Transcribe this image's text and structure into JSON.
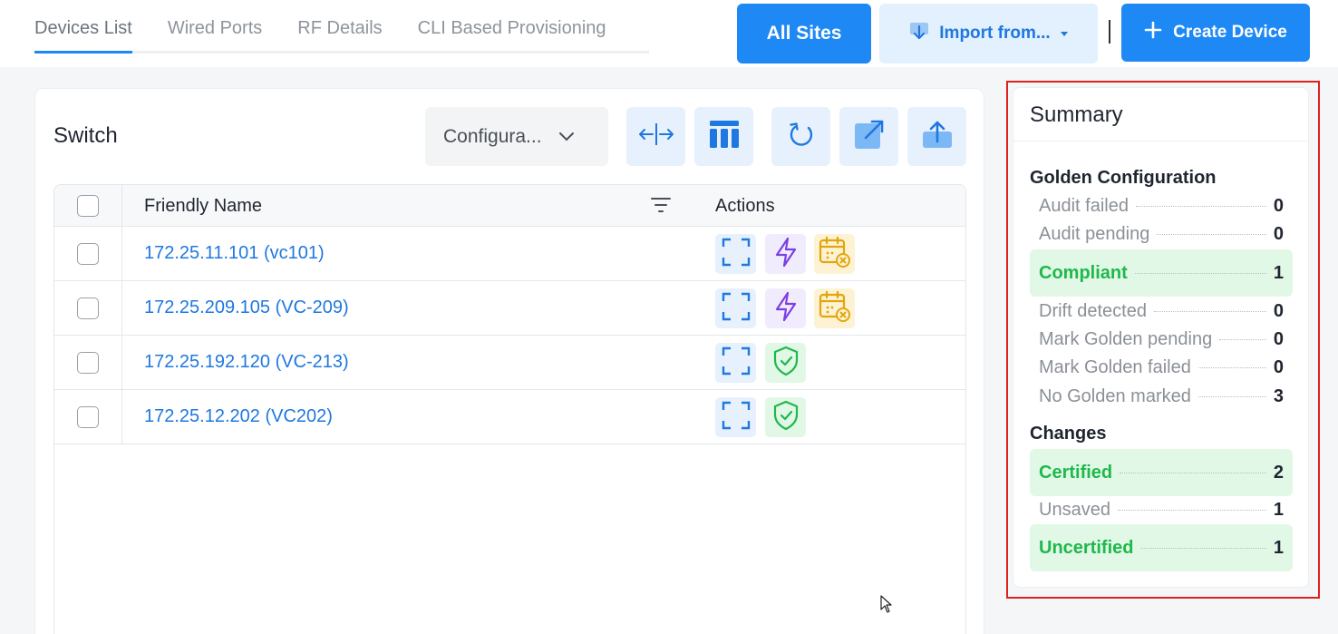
{
  "tabs": [
    {
      "label": "Devices List",
      "active": true
    },
    {
      "label": "Wired Ports"
    },
    {
      "label": "RF Details"
    },
    {
      "label": "CLI Based Provisioning"
    }
  ],
  "header": {
    "sites_label": "All Sites",
    "import_label": "Import from...",
    "create_label": "Create Device"
  },
  "card": {
    "title": "Switch",
    "dropdown_value": "Configura...",
    "columns": {
      "name": "Friendly Name",
      "actions": "Actions"
    },
    "rows": [
      {
        "name": "172.25.11.101 (vc101)",
        "actions": [
          "expand",
          "bolt",
          "calendar-x"
        ]
      },
      {
        "name": "172.25.209.105 (VC-209)",
        "actions": [
          "expand",
          "bolt",
          "calendar-x"
        ]
      },
      {
        "name": "172.25.192.120 (VC-213)",
        "actions": [
          "expand",
          "shield-check"
        ]
      },
      {
        "name": "172.25.12.202 (VC202)",
        "actions": [
          "expand",
          "shield-check"
        ]
      }
    ]
  },
  "summary": {
    "title": "Summary",
    "golden": {
      "title": "Golden Configuration",
      "items": [
        {
          "label": "Audit failed",
          "value": "0"
        },
        {
          "label": "Audit pending",
          "value": "0"
        },
        {
          "label": "Compliant",
          "value": "1",
          "highlight": true
        },
        {
          "label": "Drift detected",
          "value": "0"
        },
        {
          "label": "Mark Golden pending",
          "value": "0"
        },
        {
          "label": "Mark Golden failed",
          "value": "0"
        },
        {
          "label": "No Golden marked",
          "value": "3"
        }
      ]
    },
    "changes": {
      "title": "Changes",
      "items": [
        {
          "label": "Certified",
          "value": "2",
          "highlight": true
        },
        {
          "label": "Unsaved",
          "value": "1"
        },
        {
          "label": "Uncertified",
          "value": "1",
          "highlight": true
        }
      ]
    }
  },
  "colors": {
    "accent": "#1e88f5",
    "success": "#1fb84a",
    "highlight_box": "#e02020"
  }
}
